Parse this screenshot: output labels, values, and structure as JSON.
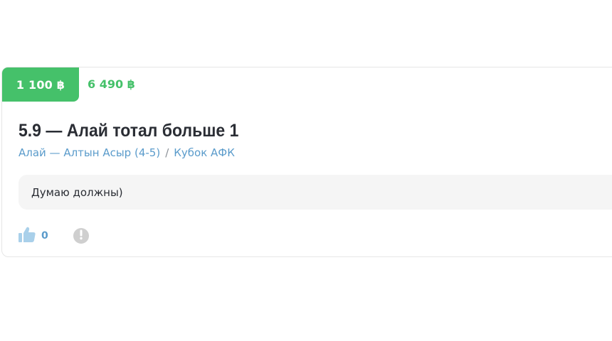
{
  "card": {
    "stake": "1 100 ฿",
    "payout": "6 490 ฿",
    "title": "5.9 — Алай тотал больше 1",
    "match_link": "Алай — Алтын Асыр (4-5)",
    "separator": "/",
    "tournament_link": "Кубок АФК",
    "comment": "Думаю должны)",
    "likes": "0"
  },
  "colors": {
    "accent_green": "#45c16a",
    "link_blue": "#5a9bcb",
    "title_dark": "#2a2d34",
    "comment_bg": "#f5f5f5"
  },
  "icons": {
    "like": "thumbs-up-icon",
    "report": "exclamation-icon"
  }
}
